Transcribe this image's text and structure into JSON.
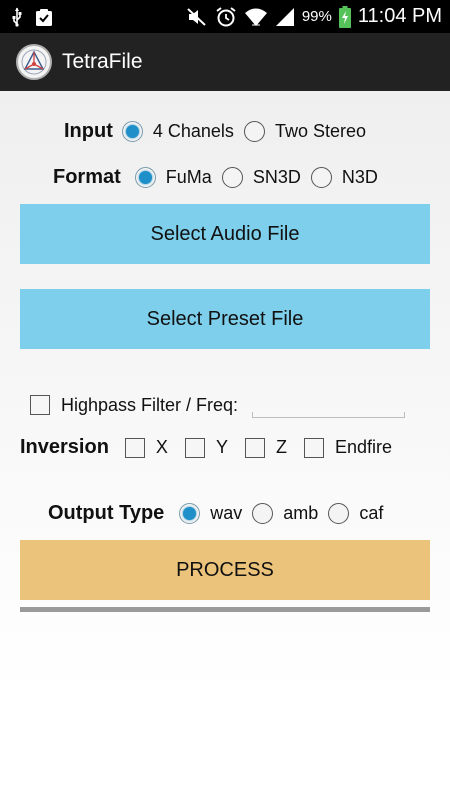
{
  "status_bar": {
    "battery_percent": "99%",
    "time": "11:04 PM",
    "icons": [
      "usb-icon",
      "clipboard-check-icon",
      "mute-icon",
      "alarm-icon",
      "wifi-icon",
      "signal-icon",
      "battery-charging-icon"
    ]
  },
  "action_bar": {
    "title": "TetraFile",
    "logo_icon": "tetrahedron-logo-icon"
  },
  "input": {
    "label": "Input",
    "options": [
      "4 Chanels",
      "Two Stereo"
    ],
    "selected": "4 Chanels"
  },
  "format": {
    "label": "Format",
    "options": [
      "FuMa",
      "SN3D",
      "N3D"
    ],
    "selected": "FuMa"
  },
  "buttons": {
    "select_audio": "Select Audio File",
    "select_preset": "Select Preset File",
    "process": "PROCESS"
  },
  "highpass": {
    "label": "Highpass Filter / Freq:",
    "checked": false,
    "freq_value": ""
  },
  "inversion": {
    "label": "Inversion",
    "options": [
      "X",
      "Y",
      "Z",
      "Endfire"
    ]
  },
  "output_type": {
    "label": "Output Type",
    "options": [
      "wav",
      "amb",
      "caf"
    ],
    "selected": "wav"
  },
  "colors": {
    "button_blue": "#7dcfec",
    "button_orange": "#ecc37a",
    "radio_selected": "#1e8fc8",
    "action_bar": "#222222"
  }
}
